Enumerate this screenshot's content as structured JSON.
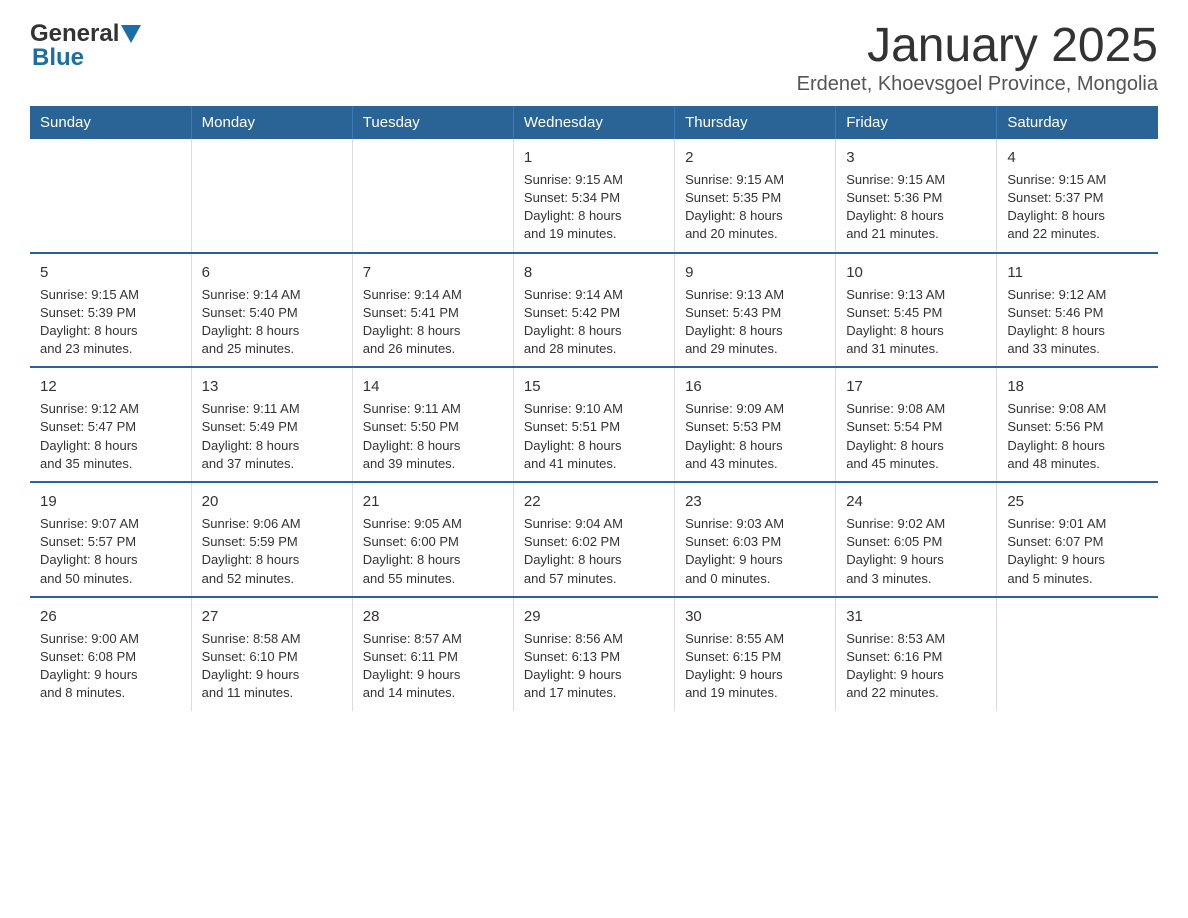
{
  "logo": {
    "general": "General",
    "blue": "Blue"
  },
  "title": "January 2025",
  "subtitle": "Erdenet, Khoevsgoel Province, Mongolia",
  "weekdays": [
    "Sunday",
    "Monday",
    "Tuesday",
    "Wednesday",
    "Thursday",
    "Friday",
    "Saturday"
  ],
  "weeks": [
    [
      {
        "day": "",
        "info": ""
      },
      {
        "day": "",
        "info": ""
      },
      {
        "day": "",
        "info": ""
      },
      {
        "day": "1",
        "info": "Sunrise: 9:15 AM\nSunset: 5:34 PM\nDaylight: 8 hours\nand 19 minutes."
      },
      {
        "day": "2",
        "info": "Sunrise: 9:15 AM\nSunset: 5:35 PM\nDaylight: 8 hours\nand 20 minutes."
      },
      {
        "day": "3",
        "info": "Sunrise: 9:15 AM\nSunset: 5:36 PM\nDaylight: 8 hours\nand 21 minutes."
      },
      {
        "day": "4",
        "info": "Sunrise: 9:15 AM\nSunset: 5:37 PM\nDaylight: 8 hours\nand 22 minutes."
      }
    ],
    [
      {
        "day": "5",
        "info": "Sunrise: 9:15 AM\nSunset: 5:39 PM\nDaylight: 8 hours\nand 23 minutes."
      },
      {
        "day": "6",
        "info": "Sunrise: 9:14 AM\nSunset: 5:40 PM\nDaylight: 8 hours\nand 25 minutes."
      },
      {
        "day": "7",
        "info": "Sunrise: 9:14 AM\nSunset: 5:41 PM\nDaylight: 8 hours\nand 26 minutes."
      },
      {
        "day": "8",
        "info": "Sunrise: 9:14 AM\nSunset: 5:42 PM\nDaylight: 8 hours\nand 28 minutes."
      },
      {
        "day": "9",
        "info": "Sunrise: 9:13 AM\nSunset: 5:43 PM\nDaylight: 8 hours\nand 29 minutes."
      },
      {
        "day": "10",
        "info": "Sunrise: 9:13 AM\nSunset: 5:45 PM\nDaylight: 8 hours\nand 31 minutes."
      },
      {
        "day": "11",
        "info": "Sunrise: 9:12 AM\nSunset: 5:46 PM\nDaylight: 8 hours\nand 33 minutes."
      }
    ],
    [
      {
        "day": "12",
        "info": "Sunrise: 9:12 AM\nSunset: 5:47 PM\nDaylight: 8 hours\nand 35 minutes."
      },
      {
        "day": "13",
        "info": "Sunrise: 9:11 AM\nSunset: 5:49 PM\nDaylight: 8 hours\nand 37 minutes."
      },
      {
        "day": "14",
        "info": "Sunrise: 9:11 AM\nSunset: 5:50 PM\nDaylight: 8 hours\nand 39 minutes."
      },
      {
        "day": "15",
        "info": "Sunrise: 9:10 AM\nSunset: 5:51 PM\nDaylight: 8 hours\nand 41 minutes."
      },
      {
        "day": "16",
        "info": "Sunrise: 9:09 AM\nSunset: 5:53 PM\nDaylight: 8 hours\nand 43 minutes."
      },
      {
        "day": "17",
        "info": "Sunrise: 9:08 AM\nSunset: 5:54 PM\nDaylight: 8 hours\nand 45 minutes."
      },
      {
        "day": "18",
        "info": "Sunrise: 9:08 AM\nSunset: 5:56 PM\nDaylight: 8 hours\nand 48 minutes."
      }
    ],
    [
      {
        "day": "19",
        "info": "Sunrise: 9:07 AM\nSunset: 5:57 PM\nDaylight: 8 hours\nand 50 minutes."
      },
      {
        "day": "20",
        "info": "Sunrise: 9:06 AM\nSunset: 5:59 PM\nDaylight: 8 hours\nand 52 minutes."
      },
      {
        "day": "21",
        "info": "Sunrise: 9:05 AM\nSunset: 6:00 PM\nDaylight: 8 hours\nand 55 minutes."
      },
      {
        "day": "22",
        "info": "Sunrise: 9:04 AM\nSunset: 6:02 PM\nDaylight: 8 hours\nand 57 minutes."
      },
      {
        "day": "23",
        "info": "Sunrise: 9:03 AM\nSunset: 6:03 PM\nDaylight: 9 hours\nand 0 minutes."
      },
      {
        "day": "24",
        "info": "Sunrise: 9:02 AM\nSunset: 6:05 PM\nDaylight: 9 hours\nand 3 minutes."
      },
      {
        "day": "25",
        "info": "Sunrise: 9:01 AM\nSunset: 6:07 PM\nDaylight: 9 hours\nand 5 minutes."
      }
    ],
    [
      {
        "day": "26",
        "info": "Sunrise: 9:00 AM\nSunset: 6:08 PM\nDaylight: 9 hours\nand 8 minutes."
      },
      {
        "day": "27",
        "info": "Sunrise: 8:58 AM\nSunset: 6:10 PM\nDaylight: 9 hours\nand 11 minutes."
      },
      {
        "day": "28",
        "info": "Sunrise: 8:57 AM\nSunset: 6:11 PM\nDaylight: 9 hours\nand 14 minutes."
      },
      {
        "day": "29",
        "info": "Sunrise: 8:56 AM\nSunset: 6:13 PM\nDaylight: 9 hours\nand 17 minutes."
      },
      {
        "day": "30",
        "info": "Sunrise: 8:55 AM\nSunset: 6:15 PM\nDaylight: 9 hours\nand 19 minutes."
      },
      {
        "day": "31",
        "info": "Sunrise: 8:53 AM\nSunset: 6:16 PM\nDaylight: 9 hours\nand 22 minutes."
      },
      {
        "day": "",
        "info": ""
      }
    ]
  ]
}
